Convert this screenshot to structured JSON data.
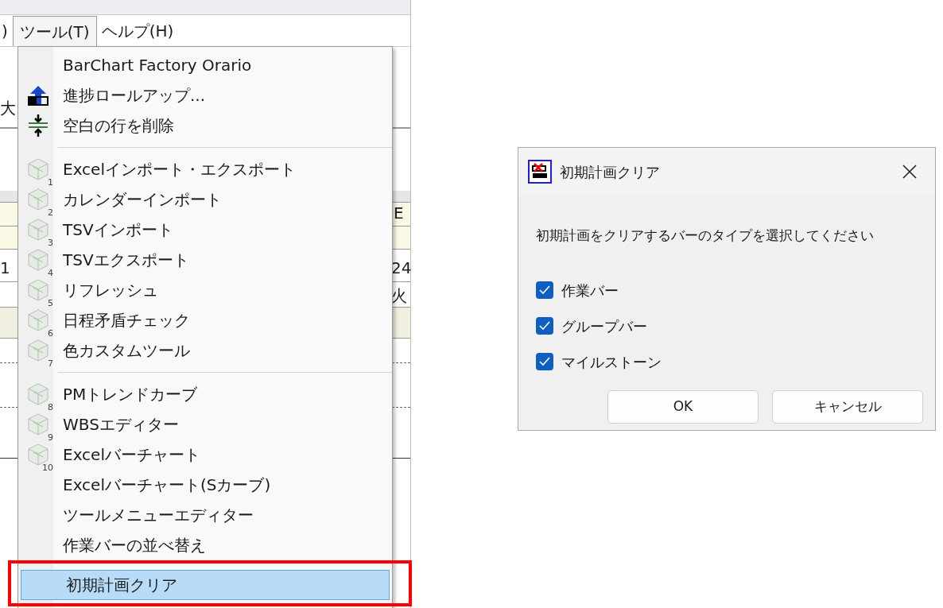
{
  "menubar": [
    {
      "label": ")",
      "selected": false
    },
    {
      "label": "ツール(T)",
      "selected": true
    },
    {
      "label": "ヘルプ(H)",
      "selected": false
    }
  ],
  "background_texts": [
    {
      "text": "大",
      "kind": "left"
    },
    {
      "text": "1",
      "kind": "left"
    },
    {
      "text": "E",
      "kind": "right"
    },
    {
      "text": "24",
      "kind": "right"
    },
    {
      "text": "火",
      "kind": "right"
    }
  ],
  "menu": {
    "items": [
      {
        "label": "BarChart Factory Orario",
        "kind": "plain",
        "selected": false
      },
      {
        "label": "進捗ロールアップ...",
        "kind": "rollup",
        "selected": false
      },
      {
        "label": "空白の行を削除",
        "kind": "delete-rows",
        "selected": false
      },
      {
        "kind": "separator"
      },
      {
        "label": "Excelインポート・エクスポート",
        "kind": "tool",
        "number": "1",
        "selected": false
      },
      {
        "label": "カレンダーインポート",
        "kind": "tool",
        "number": "2",
        "selected": false
      },
      {
        "label": "TSVインポート",
        "kind": "tool",
        "number": "3",
        "selected": false
      },
      {
        "label": "TSVエクスポート",
        "kind": "tool",
        "number": "4",
        "selected": false
      },
      {
        "label": "リフレッシュ",
        "kind": "tool",
        "number": "5",
        "selected": false
      },
      {
        "label": "日程矛盾チェック",
        "kind": "tool",
        "number": "6",
        "selected": false
      },
      {
        "label": "色カスタムツール",
        "kind": "tool",
        "number": "7",
        "selected": false
      },
      {
        "kind": "separator"
      },
      {
        "label": "PMトレンドカーブ",
        "kind": "tool",
        "number": "8",
        "selected": false
      },
      {
        "label": "WBSエディター",
        "kind": "tool",
        "number": "9",
        "selected": false
      },
      {
        "label": "Excelバーチャート",
        "kind": "tool",
        "number": "10",
        "selected": false
      },
      {
        "label": "Excelバーチャート(Sカーブ)",
        "kind": "plain",
        "selected": false
      },
      {
        "label": "ツールメニューエディター",
        "kind": "plain",
        "selected": false
      },
      {
        "label": "作業バーの並べ替え",
        "kind": "plain",
        "selected": false
      },
      {
        "label": "初期計画クリア",
        "kind": "plain",
        "selected": true
      }
    ]
  },
  "dialog": {
    "title": "初期計画クリア",
    "message": "初期計画をクリアするバーのタイプを選択してください",
    "checkboxes": [
      {
        "label": "作業バー",
        "checked": true
      },
      {
        "label": "グループバー",
        "checked": true
      },
      {
        "label": "マイルストーン",
        "checked": true
      }
    ],
    "buttons": [
      "OK",
      "キャンセル"
    ]
  }
}
